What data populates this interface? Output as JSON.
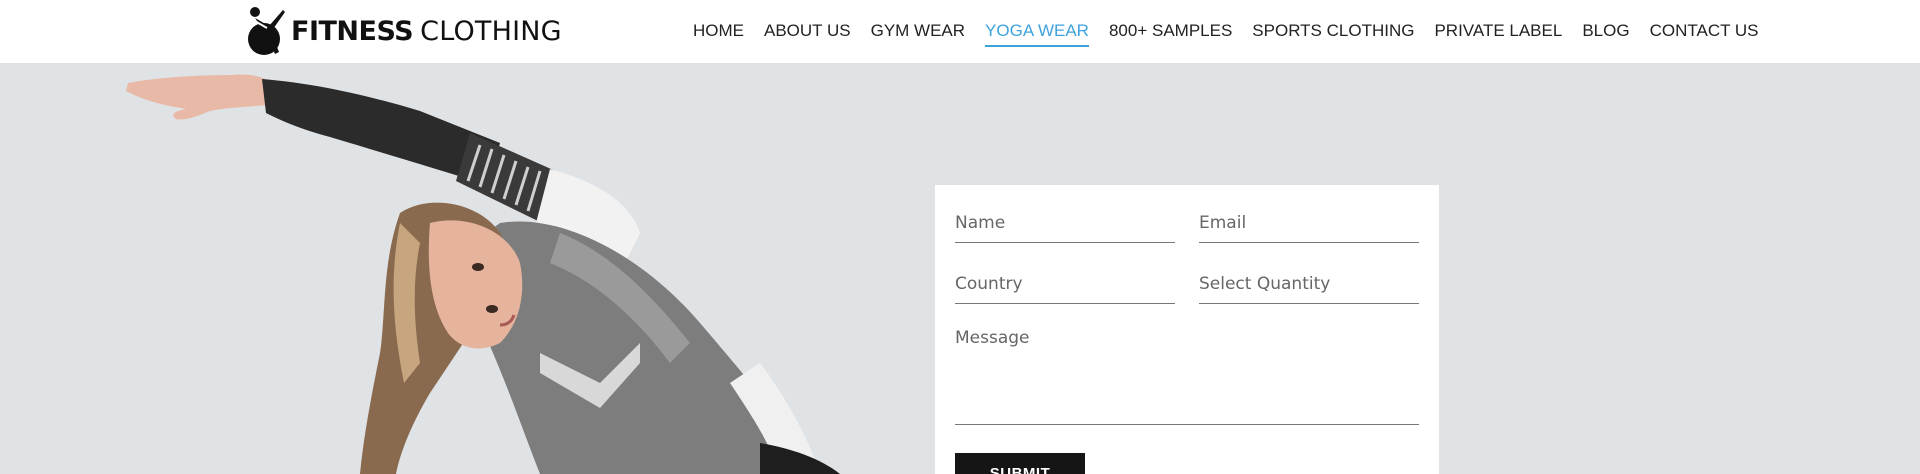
{
  "brand": {
    "name_bold": "FITNESS",
    "name_light": "CLOTHING",
    "logo_icon": "athlete-ball-icon"
  },
  "nav": {
    "items": [
      {
        "label": "HOME"
      },
      {
        "label": "ABOUT US"
      },
      {
        "label": "GYM WEAR"
      },
      {
        "label": "YOGA WEAR",
        "active": true
      },
      {
        "label": "800+ SAMPLES"
      },
      {
        "label": "SPORTS CLOTHING"
      },
      {
        "label": "PRIVATE LABEL"
      },
      {
        "label": "BLOG"
      },
      {
        "label": "CONTACT US"
      }
    ]
  },
  "form": {
    "name_placeholder": "Name",
    "email_placeholder": "Email",
    "country_placeholder": "Country",
    "quantity_placeholder": "Select Quantity",
    "message_placeholder": "Message",
    "submit_label": "SUBMIT"
  },
  "colors": {
    "accent": "#3ea3dd",
    "hero_bg": "#e0e3e6",
    "button_bg": "#151515"
  }
}
